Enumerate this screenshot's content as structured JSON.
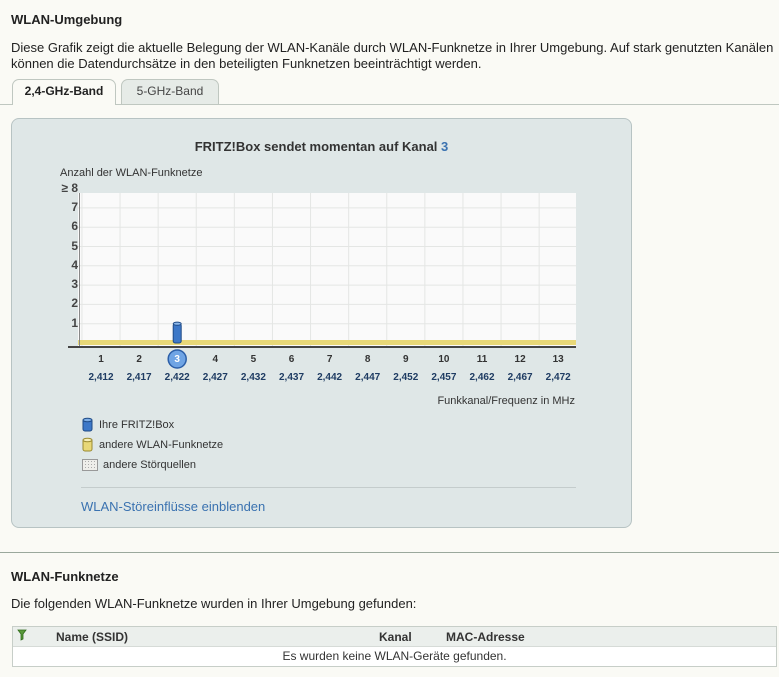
{
  "section1": {
    "title": "WLAN-Umgebung",
    "description": "Diese Grafik zeigt die aktuelle Belegung der WLAN-Kanäle durch WLAN-Funknetze in Ihrer Umgebung. Auf stark genutzten Kanälen können die Datendurchsätze in den beteiligten Funknetzen beeinträchtigt werden."
  },
  "tabs": [
    {
      "label": "2,4-GHz-Band",
      "active": true
    },
    {
      "label": "5-GHz-Band",
      "active": false
    }
  ],
  "chart": {
    "title_prefix": "FRITZ!Box sendet momentan auf Kanal ",
    "current_channel": "3",
    "yaxis_title": "Anzahl der WLAN-Funknetze",
    "xaxis_title": "Funkkanal/Frequenz in MHz",
    "toggle_link": "WLAN-Störeinflüsse einblenden",
    "legend": [
      {
        "label": "Ihre FRITZ!Box",
        "icon": "fritzbox-cylinder-icon"
      },
      {
        "label": "andere WLAN-Funknetze",
        "icon": "other-network-cylinder-icon"
      },
      {
        "label": "andere Störquellen",
        "icon": "interference-pattern-icon"
      }
    ],
    "colors": {
      "own": "#3d78c8",
      "others": "#e8d878",
      "interference": "#e0e0d8",
      "accent": "#3a72b0"
    }
  },
  "chart_data": {
    "type": "bar",
    "categories": [
      "1",
      "2",
      "3",
      "4",
      "5",
      "6",
      "7",
      "8",
      "9",
      "10",
      "11",
      "12",
      "13"
    ],
    "frequencies": [
      "2,412",
      "2,417",
      "2,422",
      "2,427",
      "2,432",
      "2,437",
      "2,442",
      "2,447",
      "2,452",
      "2,457",
      "2,462",
      "2,467",
      "2,472"
    ],
    "yticks": [
      "1",
      "2",
      "3",
      "4",
      "5",
      "6",
      "7",
      "≥ 8"
    ],
    "ylim": [
      0,
      8
    ],
    "series": [
      {
        "name": "Ihre FRITZ!Box",
        "values": [
          0,
          0,
          1,
          0,
          0,
          0,
          0,
          0,
          0,
          0,
          0,
          0,
          0
        ]
      },
      {
        "name": "andere WLAN-Funknetze",
        "values": [
          0,
          0,
          0,
          0,
          0,
          0,
          0,
          0,
          0,
          0,
          0,
          0,
          0
        ]
      }
    ],
    "xlabel": "Funkkanal/Frequenz in MHz",
    "ylabel": "Anzahl der WLAN-Funknetze",
    "grid": true
  },
  "section2": {
    "title": "WLAN-Funknetze",
    "description": "Die folgenden WLAN-Funknetze wurden in Ihrer Umgebung gefunden:",
    "table": {
      "filter_icon": "filter-icon",
      "columns": [
        "Name (SSID)",
        "Kanal",
        "MAC-Adresse"
      ],
      "empty_message": "Es wurden keine WLAN-Geräte gefunden."
    }
  }
}
